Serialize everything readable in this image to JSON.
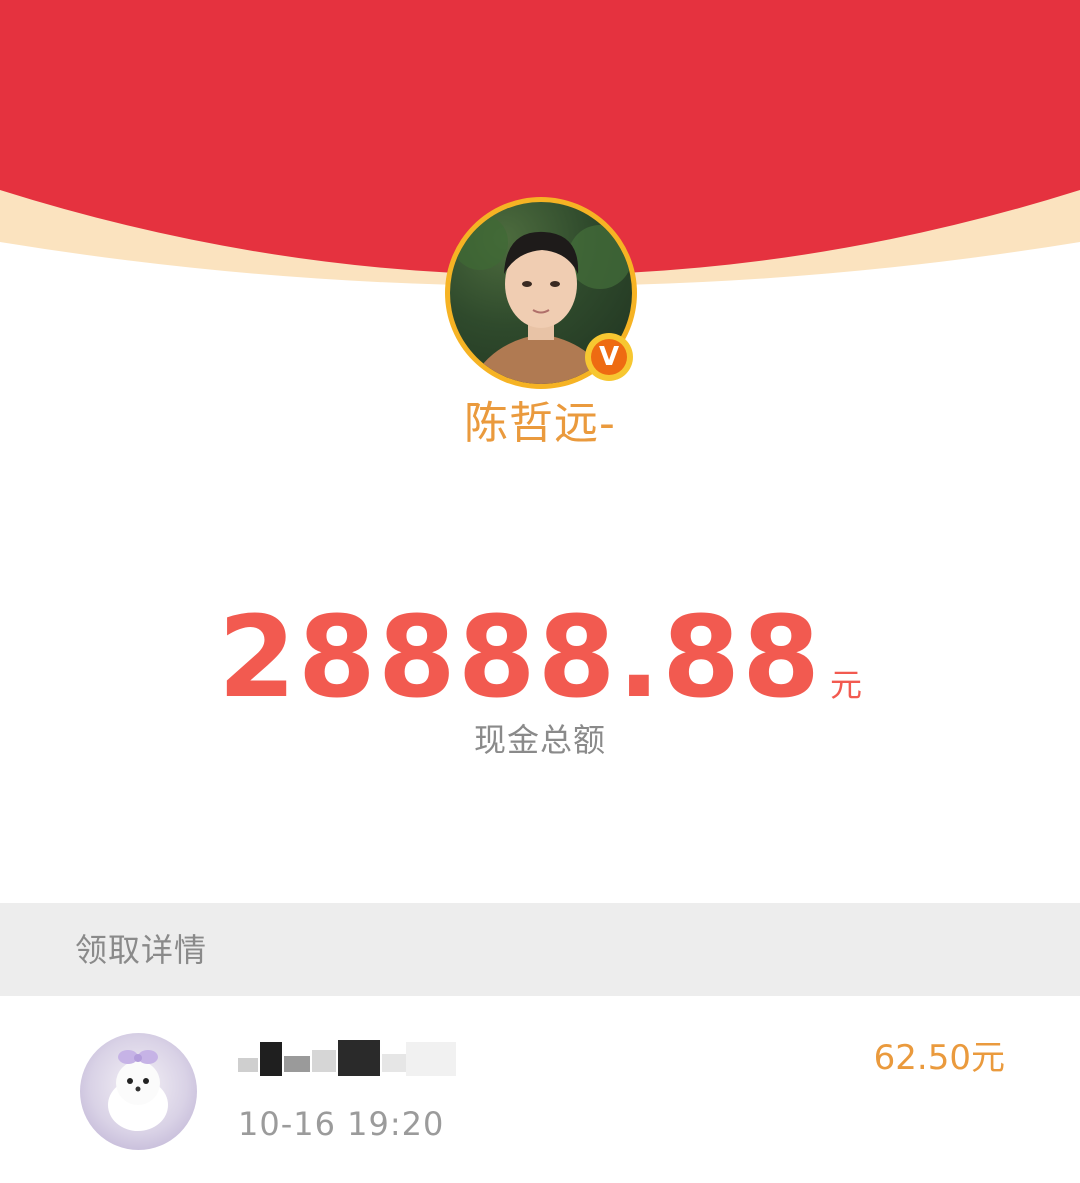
{
  "colors": {
    "header_red": "#e5323f",
    "header_rim": "#fbe3bf",
    "accent_orange": "#ea9a3d",
    "amount_red": "#f25a50",
    "muted_gray": "#8a8a8a",
    "section_bg": "#ededed"
  },
  "sender": {
    "avatar": "sender-avatar-photo",
    "verified_badge": "V",
    "name": "陈哲远-"
  },
  "total": {
    "amount": "28888.88",
    "unit": "元",
    "caption": "现金总额"
  },
  "details": {
    "section_title": "领取详情",
    "records": [
      {
        "avatar": "recipient-avatar-dog-photo",
        "name": "",
        "time": "10-16 19:20",
        "amount": "62.50元"
      }
    ]
  }
}
